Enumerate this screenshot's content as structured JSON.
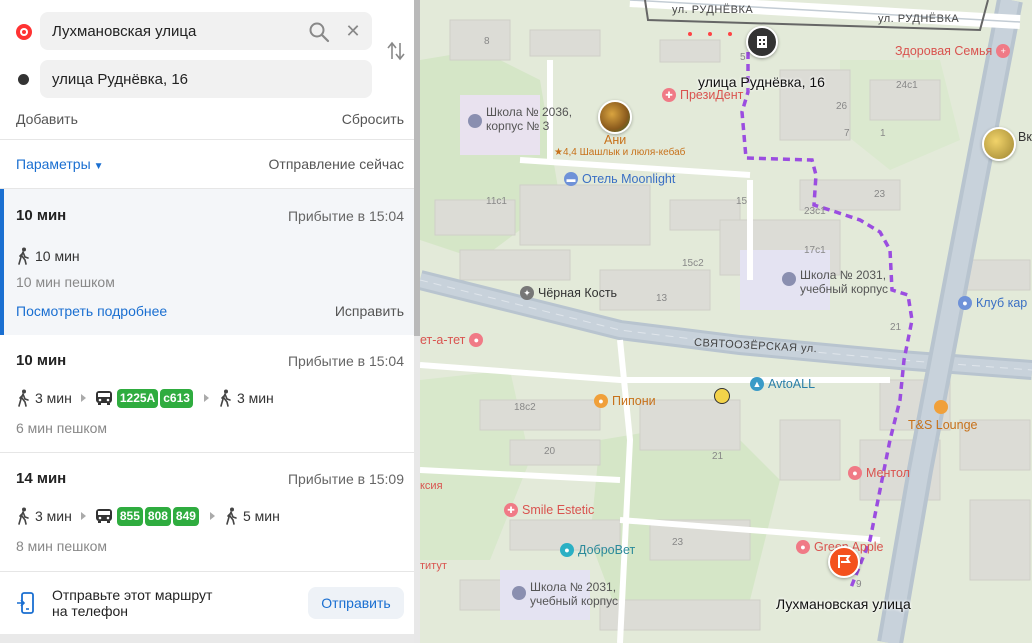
{
  "search": {
    "from_value": "Лухмановская улица",
    "to_value": "улица Руднёвка, 16",
    "add_label": "Добавить",
    "reset_label": "Сбросить"
  },
  "params": {
    "label": "Параметры",
    "departure": "Отправление сейчас"
  },
  "routes": [
    {
      "duration": "10 мин",
      "arrival": "Прибытие в 15:04",
      "legs": {
        "walk1": "10 мин"
      },
      "walk_total": "10 мин пешком",
      "details_label": "Посмотреть подробнее",
      "fix_label": "Исправить"
    },
    {
      "duration": "10 мин",
      "arrival": "Прибытие в 15:04",
      "legs": {
        "walk1": "3 мин",
        "buses": [
          "1225А",
          "с613"
        ],
        "walk2": "3 мин"
      },
      "walk_total": "6 мин пешком"
    },
    {
      "duration": "14 мин",
      "arrival": "Прибытие в 15:09",
      "legs": {
        "walk1": "3 мин",
        "buses": [
          "855",
          "808",
          "849"
        ],
        "walk2": "5 мин"
      },
      "walk_total": "8 мин пешком"
    }
  ],
  "send": {
    "text_line1": "Отправьте этот маршрут",
    "text_line2": "на телефон",
    "button": "Отправить"
  },
  "map": {
    "streets": {
      "rudnevka_1": "ул. РУДНЁВКА",
      "rudnevka_2": "ул. РУДНЁВКА",
      "svyatoozerskaya": "СВЯТООЗЁРСКАЯ ул."
    },
    "destination_label": "улица Руднёвка, 16",
    "origin_label": "Лухмановская улица",
    "pois": {
      "zdorovaya_semya": "Здоровая Семья",
      "prezident": "ПрезиДент",
      "ani_name": "Ани",
      "ani_desc": "★4,4 Шашлык и люля-кебаб",
      "otel": "Отель Moonlight",
      "chernaya_kost": "Чёрная Кость",
      "school_2036": "Школа № 2036,",
      "school_2036_2": "корпус № 3",
      "school_2031": "Школа № 2031,",
      "school_2031_2": "учебный корпус",
      "school_2031b": "Школа № 2031,",
      "school_2031b_2": "учебный корпус",
      "pipony": "Пипони",
      "avtoall": "AvtoALL",
      "tet_a_tet": "ет-а-тет",
      "klub": "Клуб кар",
      "ts_lounge": "T&S Lounge",
      "mentol": "Ментол",
      "smile": "Smile Estetic",
      "dobrovet": "ДоброВет",
      "green_apple": "Green Apple",
      "vk": "Вк",
      "aksiya": "ксия",
      "titut": "титут"
    },
    "houses": [
      "8",
      "5",
      "24с1",
      "26",
      "7",
      "1",
      "23",
      "11с1",
      "15",
      "23с1",
      "17с1",
      "15с2",
      "13",
      "21",
      "18с2",
      "20",
      "21",
      "23",
      "9"
    ],
    "colors": {
      "route": "#9b4de0",
      "origin_pin": "#f4511e",
      "road": "#b8c4cf",
      "water": "#cfe3f5"
    }
  }
}
